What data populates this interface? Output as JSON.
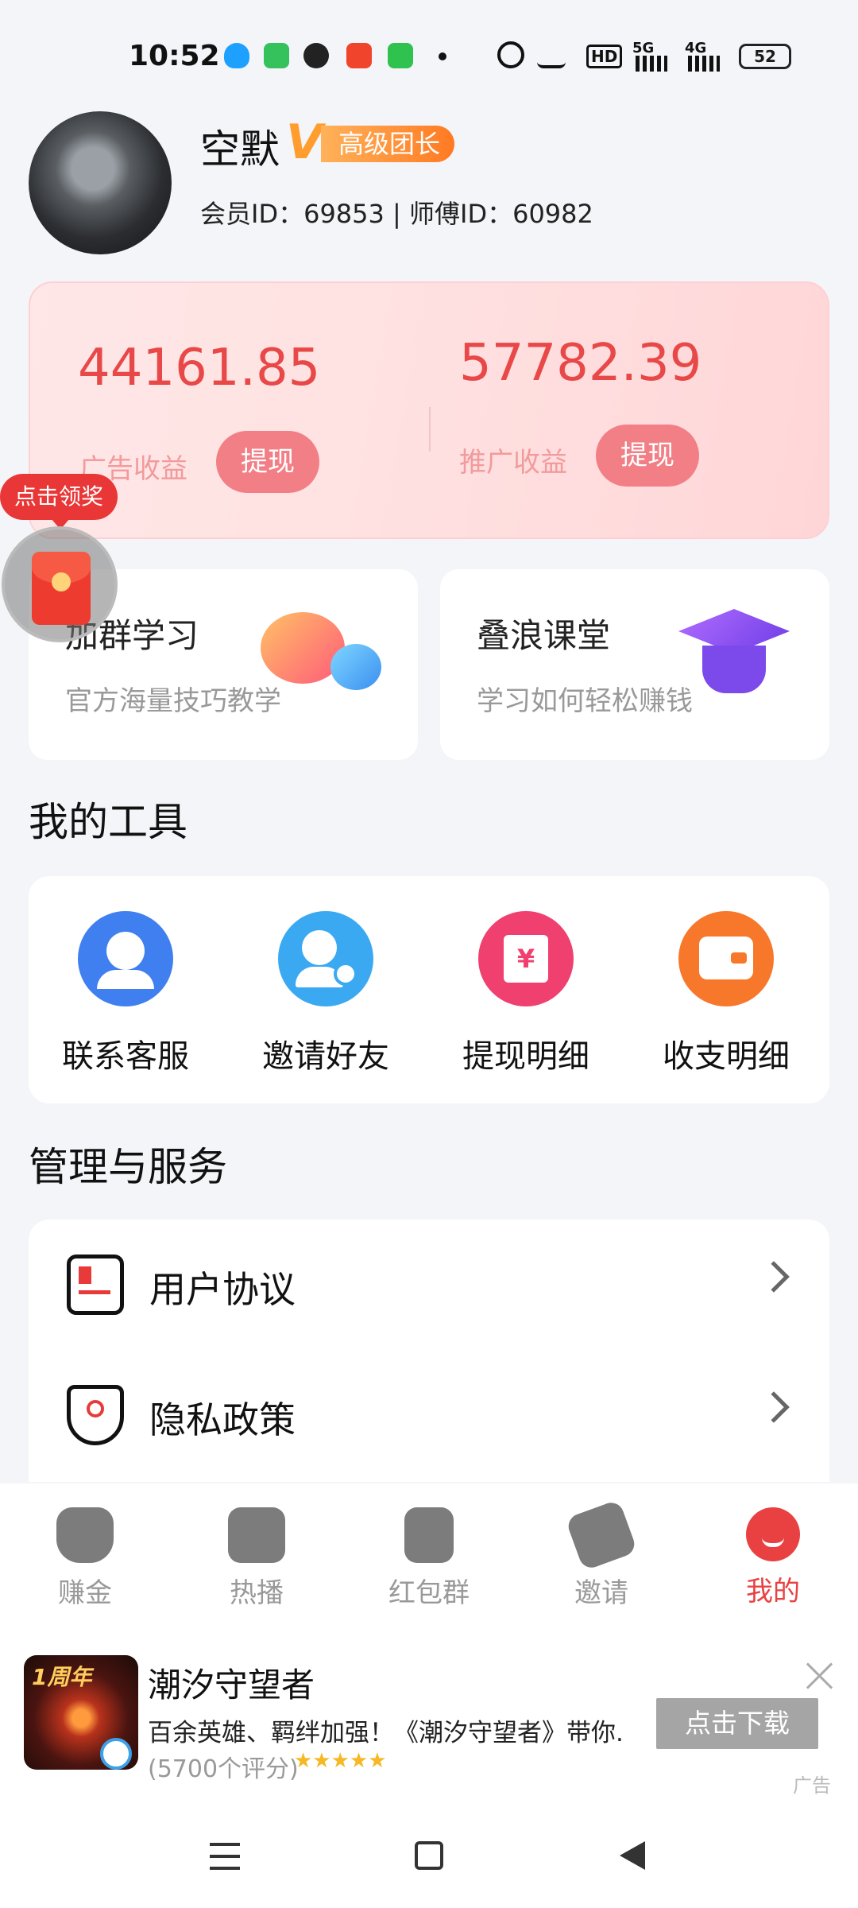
{
  "status_bar": {
    "time": "10:52",
    "net_hd": "HD",
    "net_5g": "5G",
    "net_4g": "4G",
    "battery": "52",
    "notification_icons": [
      "qq-icon",
      "message-icon",
      "wechat-icon",
      "video-icon",
      "phone-icon"
    ]
  },
  "profile": {
    "name": "空默",
    "vip_letter": "V",
    "level": "高级团长",
    "ids": "会员ID：69853 | 师傅ID：60982"
  },
  "earnings": {
    "ad_amount": "44161.85",
    "ad_label": "广告收益",
    "promo_amount": "57782.39",
    "promo_label": "推广收益",
    "withdraw_label": "提现"
  },
  "reward": {
    "label": "点击领奖"
  },
  "cards": [
    {
      "title": "加群学习",
      "subtitle": "官方海量技巧教学"
    },
    {
      "title": "叠浪课堂",
      "subtitle": "学习如何轻松赚钱"
    }
  ],
  "tools": {
    "title": "我的工具",
    "items": [
      {
        "label": "联系客服",
        "color": "#3f7ff0"
      },
      {
        "label": "邀请好友",
        "color": "#3aa9f2"
      },
      {
        "label": "提现明细",
        "color": "#f0406f"
      },
      {
        "label": "收支明细",
        "color": "#f7782a"
      }
    ]
  },
  "services": {
    "title": "管理与服务",
    "items": [
      {
        "label": "用户协议"
      },
      {
        "label": "隐私政策"
      }
    ]
  },
  "tabbar": {
    "items": [
      {
        "label": "赚金"
      },
      {
        "label": "热播"
      },
      {
        "label": "红包群"
      },
      {
        "label": "邀请"
      },
      {
        "label": "我的"
      }
    ],
    "active_color": "#e94141"
  },
  "ad": {
    "icon_text": "1周年",
    "title": "潮汐守望者",
    "desc": "百余英雄、羁绊加强！《潮汐守望者》带你...",
    "rating": "(5700个评分)",
    "stars": "★★★★★",
    "button": "点击下载",
    "tag": "广告"
  }
}
